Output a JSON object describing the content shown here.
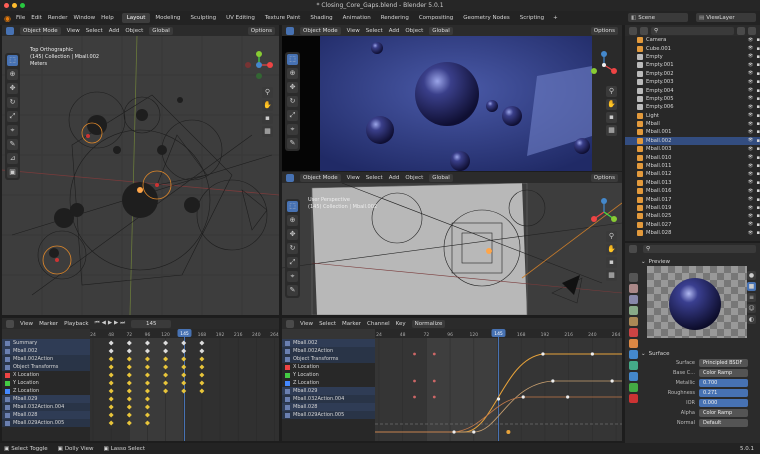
{
  "title": "* Closing_Core_Gaps.blend - Blender 5.0.1",
  "menu": [
    "File",
    "Edit",
    "Render",
    "Window",
    "Help"
  ],
  "workspaces": [
    "Layout",
    "Modeling",
    "Sculpting",
    "UV Editing",
    "Texture Paint",
    "Shading",
    "Animation",
    "Rendering",
    "Compositing",
    "Geometry Nodes",
    "Scripting"
  ],
  "plus": "+",
  "scene": "Scene",
  "viewlayer": "ViewLayer",
  "vp1": {
    "mode": "Object Mode",
    "menus": [
      "View",
      "Select",
      "Add",
      "Object"
    ],
    "orient": "Global",
    "options": "Options",
    "line1": "Top Orthographic",
    "line2": "(145) Collection | Mball.002",
    "line3": "Meters"
  },
  "vp2": {
    "mode": "Object Mode",
    "menus": [
      "View",
      "Select",
      "Add",
      "Object"
    ],
    "orient": "Global",
    "options": "Options"
  },
  "vp3": {
    "mode": "Object Mode",
    "menus": [
      "View",
      "Select",
      "Add",
      "Object"
    ],
    "orient": "Global",
    "options": "Options",
    "line1": "User Perspective",
    "line2": "(145) Collection | Mball.002"
  },
  "outliner": {
    "search": "",
    "items": [
      {
        "name": "Camera",
        "sel": false
      },
      {
        "name": "Cube.001",
        "sel": false
      },
      {
        "name": "Empty",
        "sel": false
      },
      {
        "name": "Empty.001",
        "sel": false
      },
      {
        "name": "Empty.002",
        "sel": false
      },
      {
        "name": "Empty.003",
        "sel": false
      },
      {
        "name": "Empty.004",
        "sel": false
      },
      {
        "name": "Empty.005",
        "sel": false
      },
      {
        "name": "Empty.006",
        "sel": false
      },
      {
        "name": "Light",
        "sel": false
      },
      {
        "name": "Mball",
        "sel": false
      },
      {
        "name": "Mball.001",
        "sel": false
      },
      {
        "name": "Mball.002",
        "sel": true
      },
      {
        "name": "Mball.003",
        "sel": false
      },
      {
        "name": "Mball.010",
        "sel": false
      },
      {
        "name": "Mball.011",
        "sel": false
      },
      {
        "name": "Mball.012",
        "sel": false
      },
      {
        "name": "Mball.013",
        "sel": false
      },
      {
        "name": "Mball.016",
        "sel": false
      },
      {
        "name": "Mball.017",
        "sel": false
      },
      {
        "name": "Mball.019",
        "sel": false
      },
      {
        "name": "Mball.025",
        "sel": false
      },
      {
        "name": "Mball.027",
        "sel": false
      },
      {
        "name": "Mball.028",
        "sel": false
      }
    ]
  },
  "properties": {
    "search": "",
    "preview": "Preview",
    "surface": "Surface",
    "rows": [
      {
        "k": "Surface",
        "v": "Principled BSDF"
      },
      {
        "k": "Base C...",
        "v": "Color Ramp"
      },
      {
        "k": "Metallic",
        "v": "0.700"
      },
      {
        "k": "Roughness",
        "v": "0.271"
      },
      {
        "k": "IOR",
        "v": "0.000"
      },
      {
        "k": "Alpha",
        "v": "Color Ramp"
      },
      {
        "k": "Normal",
        "v": "Default"
      }
    ]
  },
  "dopesheet": {
    "menus": [
      "View",
      "Marker",
      "Playback"
    ],
    "frame": "145",
    "ticks": [
      "24",
      "48",
      "72",
      "96",
      "120",
      "144",
      "168",
      "192",
      "216",
      "240",
      "264"
    ],
    "current": "145",
    "channels": [
      {
        "t": "Summary",
        "c": "hd"
      },
      {
        "t": "Mball.002",
        "c": "hd"
      },
      {
        "t": "Mball.002Action",
        "c": "sub"
      },
      {
        "t": "Object Transforms",
        "c": "sub"
      },
      {
        "t": "X Location",
        "c": ""
      },
      {
        "t": "Y Location",
        "c": ""
      },
      {
        "t": "Z Location",
        "c": ""
      },
      {
        "t": "Mball.029",
        "c": "hd"
      },
      {
        "t": "Mball.032Action.004",
        "c": "sub"
      },
      {
        "t": "Mball.028",
        "c": "hd"
      },
      {
        "t": "Mball.029Action.005",
        "c": "sub"
      }
    ]
  },
  "graph": {
    "menus": [
      "View",
      "Select",
      "Marker",
      "Channel",
      "Key"
    ],
    "normalize": "Normalize",
    "ticks": [
      "24",
      "48",
      "72",
      "96",
      "120",
      "144",
      "168",
      "192",
      "216",
      "240",
      "264"
    ],
    "current": "145",
    "yvals": [
      "10",
      "0"
    ],
    "channels": [
      {
        "t": "Mball.002",
        "c": "hd"
      },
      {
        "t": "Mball.002Action",
        "c": "sub"
      },
      {
        "t": "Object Transforms",
        "c": "sub"
      },
      {
        "t": "X Location",
        "c": ""
      },
      {
        "t": "Y Location",
        "c": ""
      },
      {
        "t": "Z Location",
        "c": ""
      },
      {
        "t": "Mball.029",
        "c": "hd"
      },
      {
        "t": "Mball.032Action.004",
        "c": "sub"
      },
      {
        "t": "Mball.028",
        "c": "hd"
      },
      {
        "t": "Mball.029Action.005",
        "c": "sub"
      }
    ]
  },
  "status": {
    "select": "Select Toggle",
    "view": "Dolly View",
    "lasso": "Lasso Select",
    "version": "5.0.1"
  }
}
